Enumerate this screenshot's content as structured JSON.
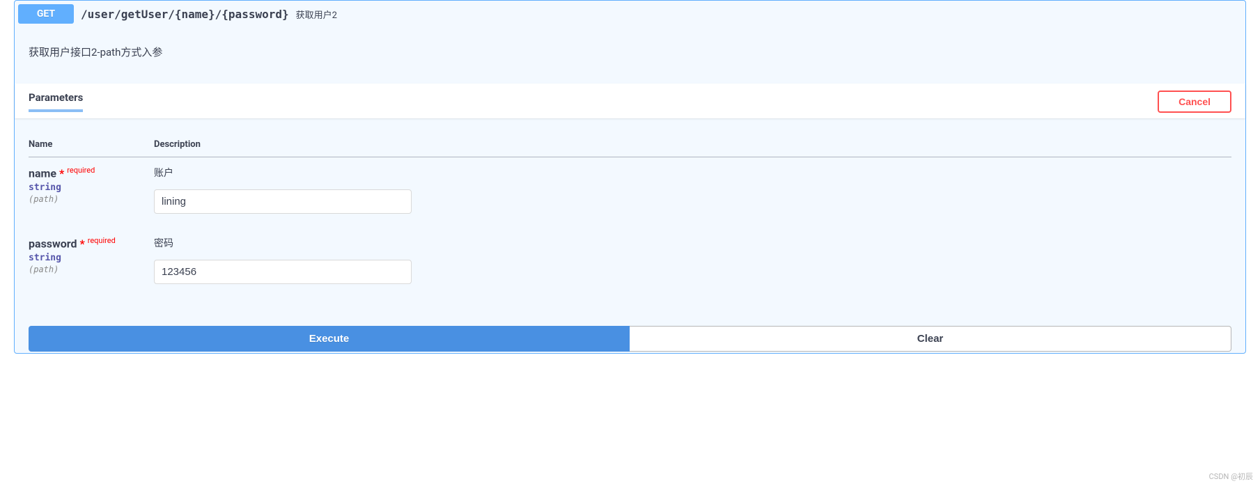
{
  "operation": {
    "method": "GET",
    "path": "/user/getUser/{name}/{password}",
    "summary": "获取用户2",
    "description": "获取用户接口2-path方式入参"
  },
  "parameters": {
    "tab_label": "Parameters",
    "cancel_label": "Cancel",
    "headers": {
      "name": "Name",
      "description": "Description"
    },
    "items": [
      {
        "name": "name",
        "required_star": "*",
        "required_label": "required",
        "type": "string",
        "location": "(path)",
        "description": "账户",
        "value": "lining"
      },
      {
        "name": "password",
        "required_star": "*",
        "required_label": "required",
        "type": "string",
        "location": "(path)",
        "description": "密码",
        "value": "123456"
      }
    ]
  },
  "actions": {
    "execute": "Execute",
    "clear": "Clear"
  },
  "watermark": "CSDN @初辰"
}
